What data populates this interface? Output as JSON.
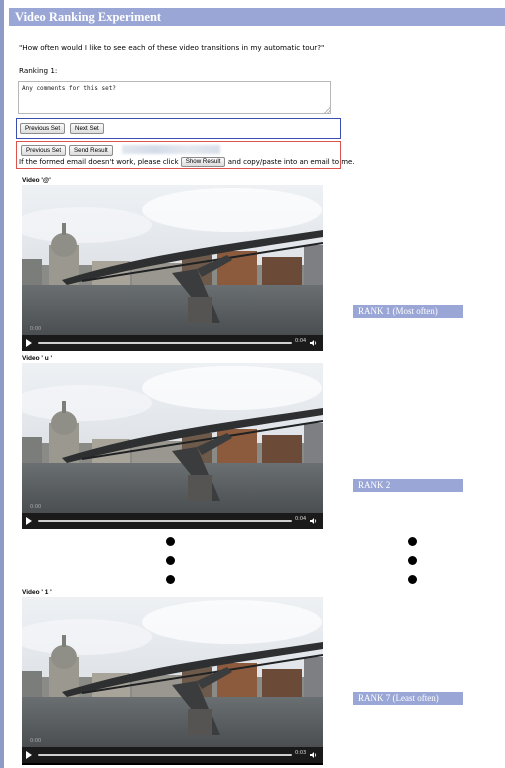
{
  "page": {
    "title": "Video Ranking Experiment",
    "question": "\"How often would I like to see each of these video transitions in my automatic tour?\"",
    "ranking_label": "Ranking 1:",
    "comments_value": "Any comments for this set?"
  },
  "nav_buttons": {
    "previous_set": "Previous Set",
    "next_set": "Next Set"
  },
  "email_section": {
    "previous_set": "Previous Set",
    "send_result": "Send Result",
    "note_before": "If the formed email doesn't work, please click",
    "show_result": "Show Result",
    "note_after": "and copy/paste into an email to me."
  },
  "videos": [
    {
      "label": "Video '@'",
      "current_time": "0:00",
      "duration": "0:04"
    },
    {
      "label": "Video ' u '",
      "current_time": "0:00",
      "duration": "0:04"
    },
    {
      "label": "Video ' 1 '",
      "current_time": "0:00",
      "duration": "0:03"
    }
  ],
  "ranks": [
    "RANK 1 (Most often)",
    "RANK 2",
    "RANK 7 (Least often)"
  ],
  "colors": {
    "title_bar": "#9aa7d6",
    "blue_outline": "#3b4fb3",
    "red_outline": "#d9534f",
    "rank_label": "#9aa7d6"
  },
  "icons": [
    "play-icon",
    "volume-icon",
    "resize-grip-icon",
    "ellipsis-dot-icon"
  ]
}
